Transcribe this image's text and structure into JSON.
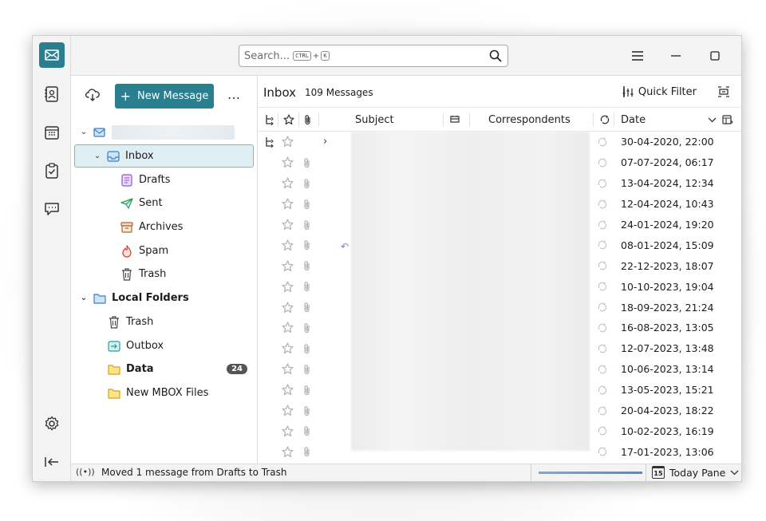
{
  "search": {
    "placeholder": "Search...",
    "key1": "CTRL",
    "plus": "+",
    "key2": "K"
  },
  "folder_pane": {
    "new_message": "New Message",
    "more": "…",
    "account_name": "",
    "folders": [
      {
        "label": "Inbox",
        "icon": "inbox-icon",
        "selected": true
      },
      {
        "label": "Drafts",
        "icon": "drafts-icon"
      },
      {
        "label": "Sent",
        "icon": "sent-icon"
      },
      {
        "label": "Archives",
        "icon": "archive-icon"
      },
      {
        "label": "Spam",
        "icon": "spam-icon"
      },
      {
        "label": "Trash",
        "icon": "trash-icon"
      }
    ],
    "local_folders": {
      "label": "Local Folders",
      "children": [
        {
          "label": "Trash",
          "icon": "trash-icon"
        },
        {
          "label": "Outbox",
          "icon": "outbox-icon"
        },
        {
          "label": "Data",
          "icon": "folder-icon",
          "badge": "24"
        },
        {
          "label": "New MBOX Files",
          "icon": "folder-icon"
        }
      ]
    }
  },
  "thread_pane": {
    "title": "Inbox",
    "count": "109 Messages",
    "quick_filter": "Quick Filter",
    "columns": {
      "subject": "Subject",
      "correspondents": "Correspondents",
      "date": "Date"
    },
    "dates": [
      "30-04-2020, 22:00",
      "07-07-2024, 06:17",
      "13-04-2024, 12:34",
      "12-04-2024, 10:43",
      "24-01-2024, 19:20",
      "08-01-2024, 15:09",
      "22-12-2023, 18:07",
      "10-10-2023, 19:04",
      "18-09-2023, 21:24",
      "16-08-2023, 13:05",
      "12-07-2023, 13:48",
      "10-06-2023, 13:14",
      "13-05-2023, 15:21",
      "20-04-2023, 18:22",
      "10-02-2023, 16:19",
      "17-01-2023, 13:06"
    ]
  },
  "status": {
    "message": "Moved 1 message from Drafts to Trash",
    "progress": 1.0,
    "today_pane": "Today Pane",
    "today_date": "15"
  },
  "colors": {
    "accent": "#2a7f8f",
    "selected_bg": "#dfeef3"
  }
}
